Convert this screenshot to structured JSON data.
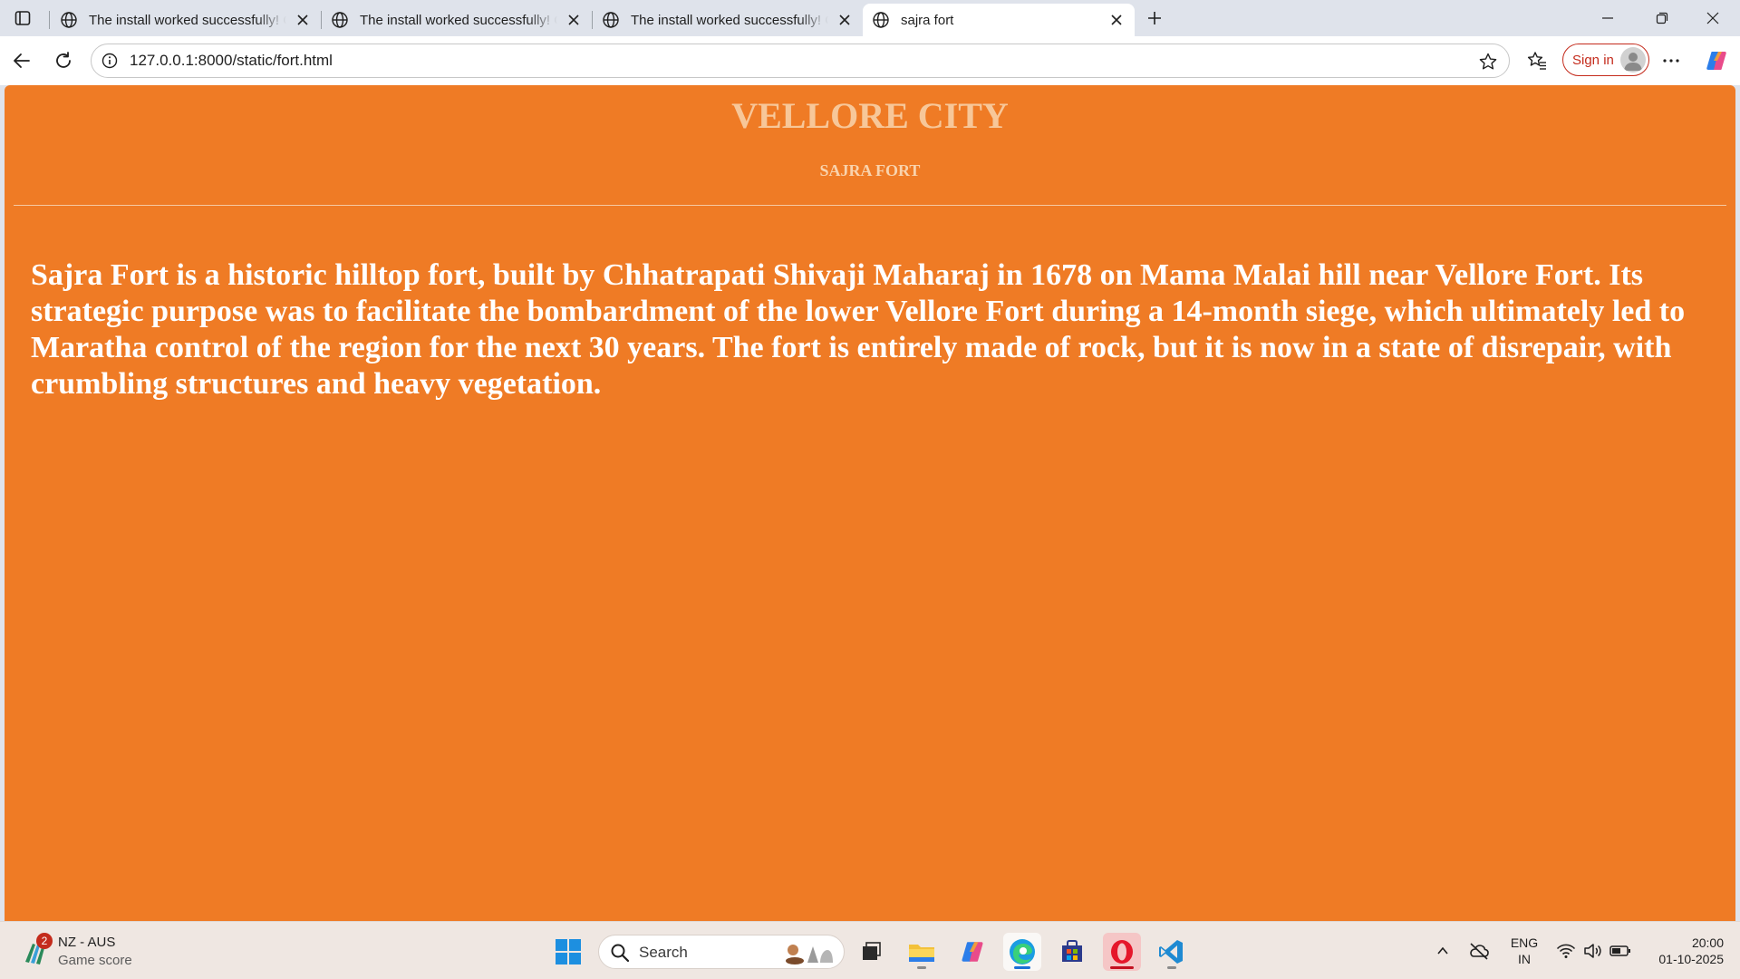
{
  "browser": {
    "tabs": [
      {
        "title": "The install worked successfully! Congratulations!",
        "active": false
      },
      {
        "title": "The install worked successfully! Congratulations!",
        "active": false
      },
      {
        "title": "The install worked successfully! Congratulations!",
        "active": false
      },
      {
        "title": "sajra fort",
        "active": true
      }
    ],
    "address": "127.0.0.1:8000/static/fort.html",
    "signin_label": "Sign in"
  },
  "page": {
    "heading": "VELLORE CITY",
    "subheading": "SAJRA FORT",
    "paragraph": "Sajra Fort is a historic hilltop fort, built by Chhatrapati Shivaji Maharaj in 1678 on Mama Malai hill near Vellore Fort. Its strategic purpose was to facilitate the bombardment of the lower Vellore Fort during a 14-month siege, which ultimately led to Maratha control of the region for the next 30 years. The fort is entirely made of rock, but it is now in a state of disrepair, with crumbling structures and heavy vegetation.",
    "background_color": "#ef7b25",
    "heading_color": "#f7c799"
  },
  "taskbar": {
    "widget": {
      "badge": "2",
      "line1": "NZ - AUS",
      "line2": "Game score"
    },
    "search_placeholder": "Search",
    "language": {
      "line1": "ENG",
      "line2": "IN"
    },
    "clock": {
      "time": "20:00",
      "date": "01-10-2025"
    }
  }
}
